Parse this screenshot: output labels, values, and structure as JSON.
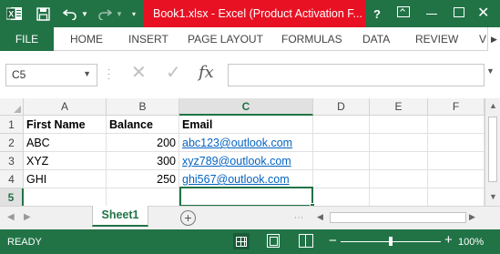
{
  "window": {
    "title": "Book1.xlsx - Excel (Product Activation F..."
  },
  "ribbon": {
    "tabs": [
      "FILE",
      "HOME",
      "INSERT",
      "PAGE LAYOUT",
      "FORMULAS",
      "DATA",
      "REVIEW",
      "VI"
    ],
    "active_tab": "FILE"
  },
  "formula_bar": {
    "name_box": "C5",
    "formula": ""
  },
  "grid": {
    "columns": [
      "A",
      "B",
      "C",
      "D",
      "E",
      "F"
    ],
    "selected_column": "C",
    "rows": [
      {
        "header": "1",
        "cells": [
          "First Name",
          "Balance",
          "Email",
          "",
          "",
          ""
        ]
      },
      {
        "header": "2",
        "cells": [
          "ABC",
          "200",
          "abc123@outlook.com",
          "",
          "",
          ""
        ]
      },
      {
        "header": "3",
        "cells": [
          "XYZ",
          "300",
          "xyz789@outlook.com",
          "",
          "",
          ""
        ]
      },
      {
        "header": "4",
        "cells": [
          "GHI",
          "250",
          "ghi567@outlook.com",
          "",
          "",
          ""
        ]
      },
      {
        "header": "5",
        "cells": [
          "",
          "",
          "",
          "",
          "",
          ""
        ]
      }
    ],
    "selected_row": "5",
    "selected_cell": "C5"
  },
  "sheets": {
    "tabs": [
      "Sheet1"
    ],
    "active": "Sheet1"
  },
  "status": {
    "text": "READY",
    "zoom_level": "100%",
    "zoom_fraction": 0.5
  },
  "colors": {
    "excel_green": "#217346",
    "title_highlight": "#e81123",
    "hyperlink": "#0563c1"
  },
  "icons": [
    "excel-app-icon",
    "save-icon",
    "undo-icon",
    "redo-icon",
    "help-icon",
    "ribbon-display-icon",
    "minimize-icon",
    "maximize-icon",
    "close-icon",
    "cancel-icon",
    "enter-icon",
    "fx-icon",
    "add-sheet-icon",
    "normal-view-icon",
    "page-layout-view-icon",
    "page-break-view-icon"
  ]
}
